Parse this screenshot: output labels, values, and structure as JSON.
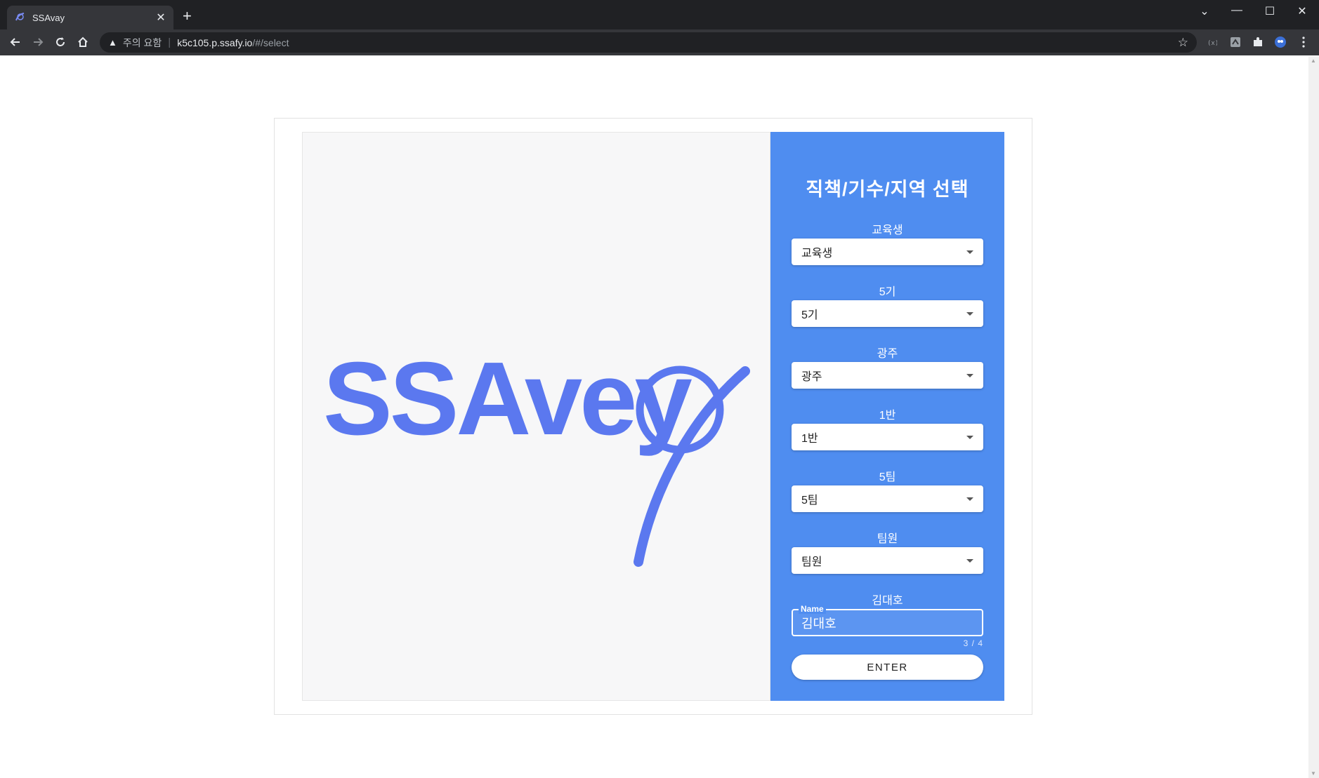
{
  "browser": {
    "tab_title": "SSAvay",
    "new_tab_symbol": "+",
    "security_warning": "주의 요함",
    "url_host": "k5c105.p.ssafy.io",
    "url_path": "/#/select"
  },
  "logo": {
    "text": "SSAvey",
    "color": "#5b78ef"
  },
  "form": {
    "title": "직책/기수/지역 선택",
    "fields": [
      {
        "label": "교육생",
        "value": "교육생"
      },
      {
        "label": "5기",
        "value": "5기"
      },
      {
        "label": "광주",
        "value": "광주"
      },
      {
        "label": "1반",
        "value": "1반"
      },
      {
        "label": "5팀",
        "value": "5팀"
      },
      {
        "label": "팀원",
        "value": "팀원"
      }
    ],
    "name_label": "김대호",
    "name_legend": "Name",
    "name_value": "김대호",
    "char_counter": "3 / 4",
    "enter_label": "ENTER"
  },
  "colors": {
    "panel_blue": "#4f8df0",
    "logo_blue": "#5b78ef"
  }
}
